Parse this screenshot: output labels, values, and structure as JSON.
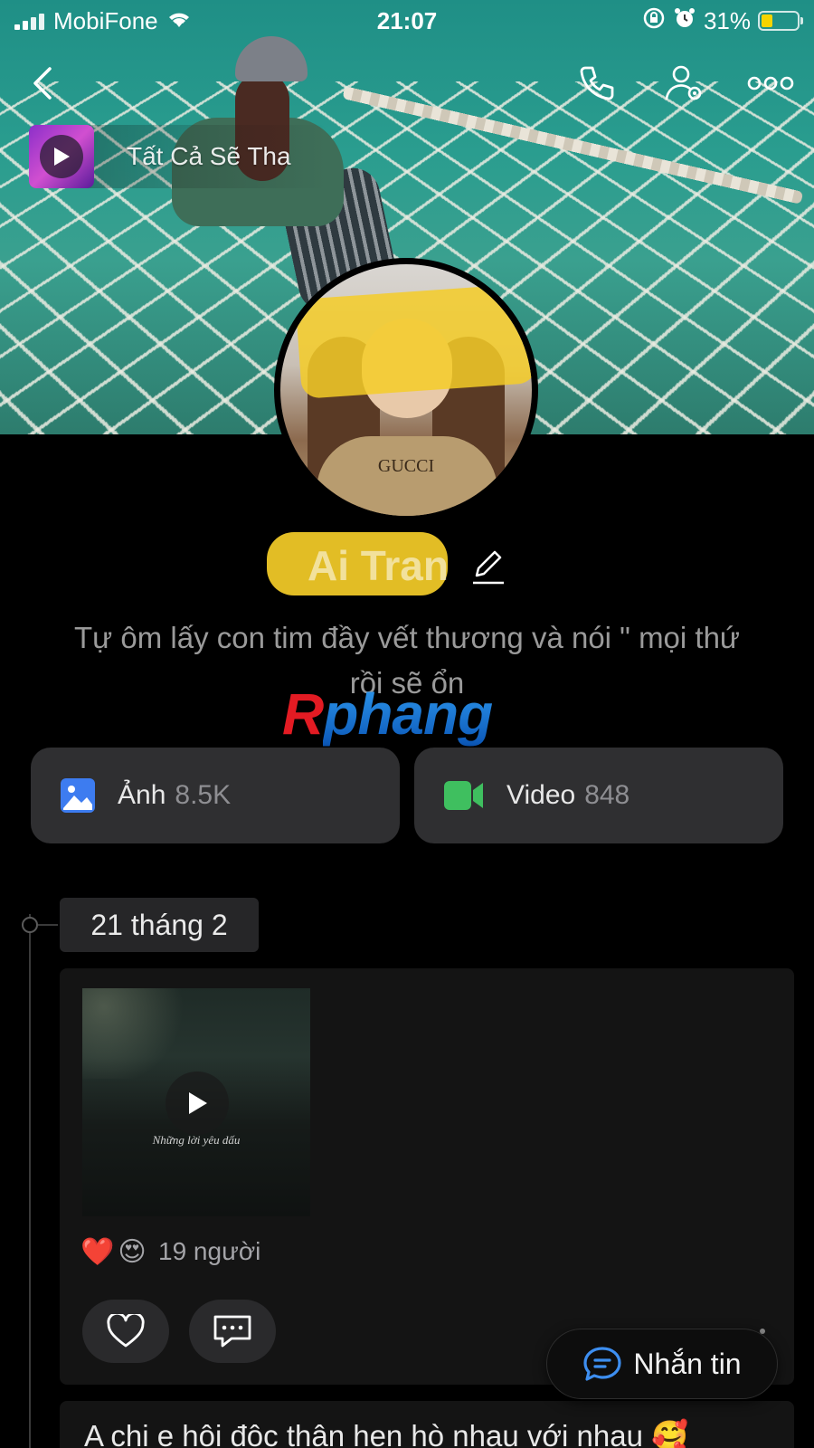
{
  "status_bar": {
    "carrier": "MobiFone",
    "time": "21:07",
    "battery_percent": "31%",
    "battery_level": 0.31,
    "battery_color": "#f5d400"
  },
  "top_nav": {
    "back_icon": "chevron-left-icon",
    "call_icon": "phone-icon",
    "user_settings_icon": "user-settings-icon",
    "more_icon": "more-horizontal-icon"
  },
  "music": {
    "title": "Tất Cả Sẽ Tha"
  },
  "profile": {
    "name": "Ai Tran",
    "bio": "Tự ôm lấy con tim đầy vết thương và nói \" mọi thứ rồi sẽ ổn",
    "avatar_shirt_text": "GUCCI"
  },
  "watermark": {
    "first": "R",
    "rest": "phang"
  },
  "media_tiles": [
    {
      "label": "Ảnh",
      "count": "8.5K",
      "icon": "image-icon",
      "color": "#3d7cf0"
    },
    {
      "label": "Video",
      "count": "848",
      "icon": "video-camera-icon",
      "color": "#3fbf5f"
    }
  ],
  "timeline": {
    "date": "21 tháng 2"
  },
  "post": {
    "video_caption": "Những lời yêu dấu",
    "reactions": [
      "❤️",
      "😍"
    ],
    "reaction_count": "19 người"
  },
  "chat_button": {
    "label": "Nhắn tin",
    "color": "#3d8ef0"
  },
  "next_post": {
    "text": "A chị e hội độc thân hẹn hò nhau với nhau 🥰"
  }
}
